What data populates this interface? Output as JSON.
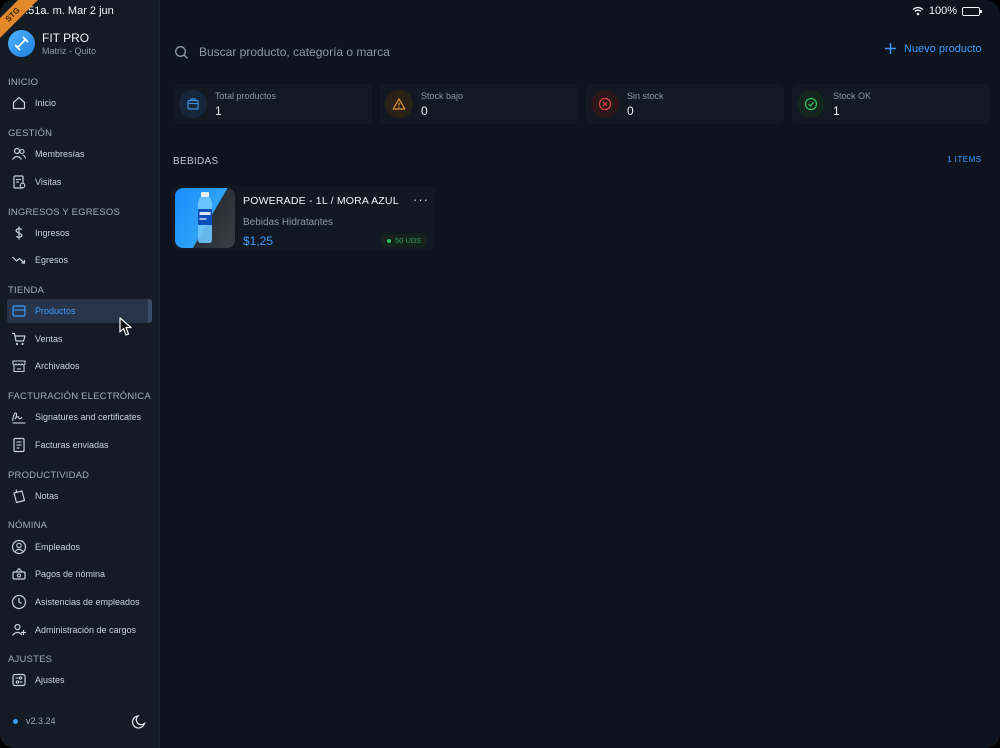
{
  "status_bar": {
    "time": "8:51a. m.   Mar 2 jun",
    "battery": "100%",
    "ribbon": "STG",
    "icons": [
      "wifi-icon",
      "battery-icon"
    ]
  },
  "brand": {
    "title": "FIT PRO",
    "subtitle": "Matriz - Quito"
  },
  "sidebar": {
    "sections": [
      {
        "label": "INICIO",
        "items": [
          {
            "label": "Inicio",
            "icon": "home-icon"
          }
        ]
      },
      {
        "label": "GESTIÓN",
        "items": [
          {
            "label": "Membresías",
            "icon": "users-icon"
          },
          {
            "label": "Visitas",
            "icon": "visits-icon"
          }
        ]
      },
      {
        "label": "INGRESOS Y EGRESOS",
        "items": [
          {
            "label": "Ingresos",
            "icon": "dollar-icon"
          },
          {
            "label": "Egresos",
            "icon": "trend-down-icon"
          }
        ]
      },
      {
        "label": "TIENDA",
        "items": [
          {
            "label": "Productos",
            "icon": "store-icon",
            "active": true
          },
          {
            "label": "Ventas",
            "icon": "cart-icon"
          },
          {
            "label": "Archivados",
            "icon": "archive-store-icon"
          }
        ]
      },
      {
        "label": "FACTURACIÓN ELECTRÓNICA",
        "items": [
          {
            "label": "Signatures and certificates",
            "icon": "signature-icon"
          },
          {
            "label": "Facturas enviadas",
            "icon": "invoice-icon"
          }
        ]
      },
      {
        "label": "PRODUCTIVIDAD",
        "items": [
          {
            "label": "Notas",
            "icon": "notes-icon"
          }
        ]
      },
      {
        "label": "NÓMINA",
        "items": [
          {
            "label": "Empleados",
            "icon": "user-circle-icon"
          },
          {
            "label": "Pagos de nómina",
            "icon": "payroll-icon"
          },
          {
            "label": "Asistencias de empleados",
            "icon": "clock-icon"
          },
          {
            "label": "Administración de cargos",
            "icon": "user-plus-icon"
          }
        ]
      },
      {
        "label": "AJUSTES",
        "items": [
          {
            "label": "Ajustes",
            "icon": "settings-icon"
          }
        ]
      }
    ],
    "version": "v2.3.24"
  },
  "search": {
    "placeholder": "Buscar producto, categoría o marca"
  },
  "new_product_label": "Nuevo producto",
  "stats": [
    {
      "label": "Total productos",
      "value": "1",
      "icon": "box-icon",
      "color": "#3d8fe0"
    },
    {
      "label": "Stock bajo",
      "value": "0",
      "icon": "warning-icon",
      "color": "#e0922f"
    },
    {
      "label": "Sin stock",
      "value": "0",
      "icon": "x-circle-icon",
      "color": "#e0474b"
    },
    {
      "label": "Stock OK",
      "value": "1",
      "icon": "check-circle-icon",
      "color": "#2fbf62"
    }
  ],
  "category": {
    "title": "BEBIDAS",
    "count": "1 ITEMS",
    "products": [
      {
        "name": "POWERADE - 1L / MORA AZUL",
        "category": "Bebidas Hidratantes",
        "price": "$1,25",
        "stock": "50 UDS"
      }
    ]
  },
  "colors": {
    "accent": "#3d9bff",
    "background": "#0e141d",
    "sidebar": "#141b25"
  }
}
